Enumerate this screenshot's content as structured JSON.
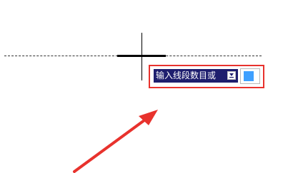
{
  "command_prompt": {
    "text": "输入线段数目或",
    "dropdown_icon": "dropdown-arrow-icon",
    "input_value": ""
  },
  "colors": {
    "prompt_background": "#1e1e6e",
    "input_fill": "#3fa0ff",
    "highlight": "#e8322d",
    "arrow": "#e8322d"
  }
}
